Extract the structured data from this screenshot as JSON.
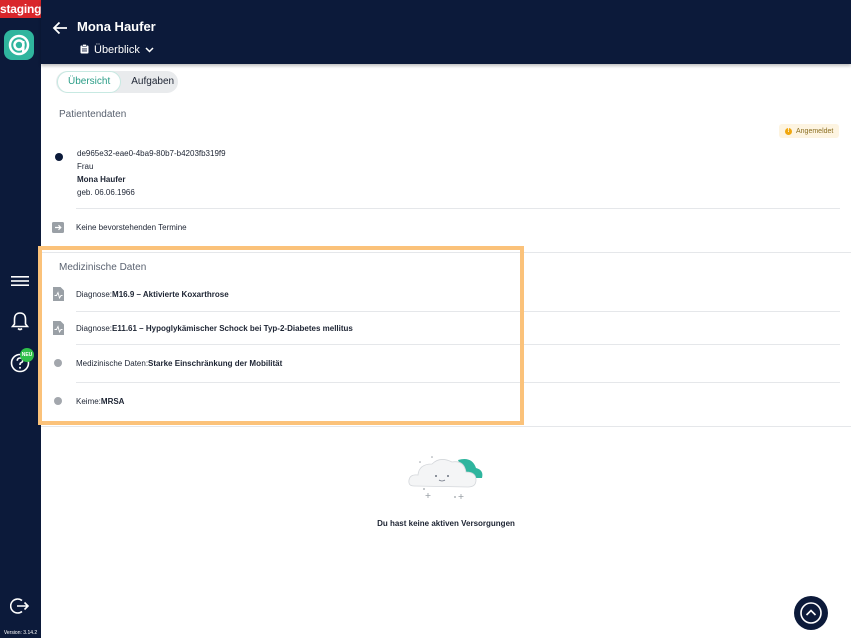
{
  "environment": {
    "label": "staging"
  },
  "sidebar": {
    "new_badge": "NEU",
    "version": "Version: 3.14.2"
  },
  "header": {
    "patient_name": "Mona Haufer",
    "view_select": "Überblick"
  },
  "tabs": [
    {
      "label": "Übersicht"
    },
    {
      "label": "Aufgaben"
    }
  ],
  "patient_section": {
    "title": "Patientendaten",
    "status": "Angemeldet",
    "id": "de965e32-eae0-4ba9-80b7-b4203fb319f9",
    "salutation": "Frau",
    "name": "Mona Haufer",
    "birth": "geb. 06.06.1966"
  },
  "appointments": {
    "label": "Keine bevorstehenden Termine"
  },
  "medical_section": {
    "title": "Medizinische Daten",
    "items": [
      {
        "prefix": "Diagnose: ",
        "value": "M16.9 – Aktivierte Koxarthrose"
      },
      {
        "prefix": "Diagnose: ",
        "value": "E11.61 – Hypoglykämischer Schock bei Typ-2-Diabetes mellitus"
      },
      {
        "prefix": "Medizinische Daten: ",
        "value": "Starke Einschränkung der Mobilität"
      },
      {
        "prefix": "Keime: ",
        "value": "MRSA"
      }
    ]
  },
  "supply_empty": {
    "text": "Du hast keine aktiven Versorgungen"
  }
}
